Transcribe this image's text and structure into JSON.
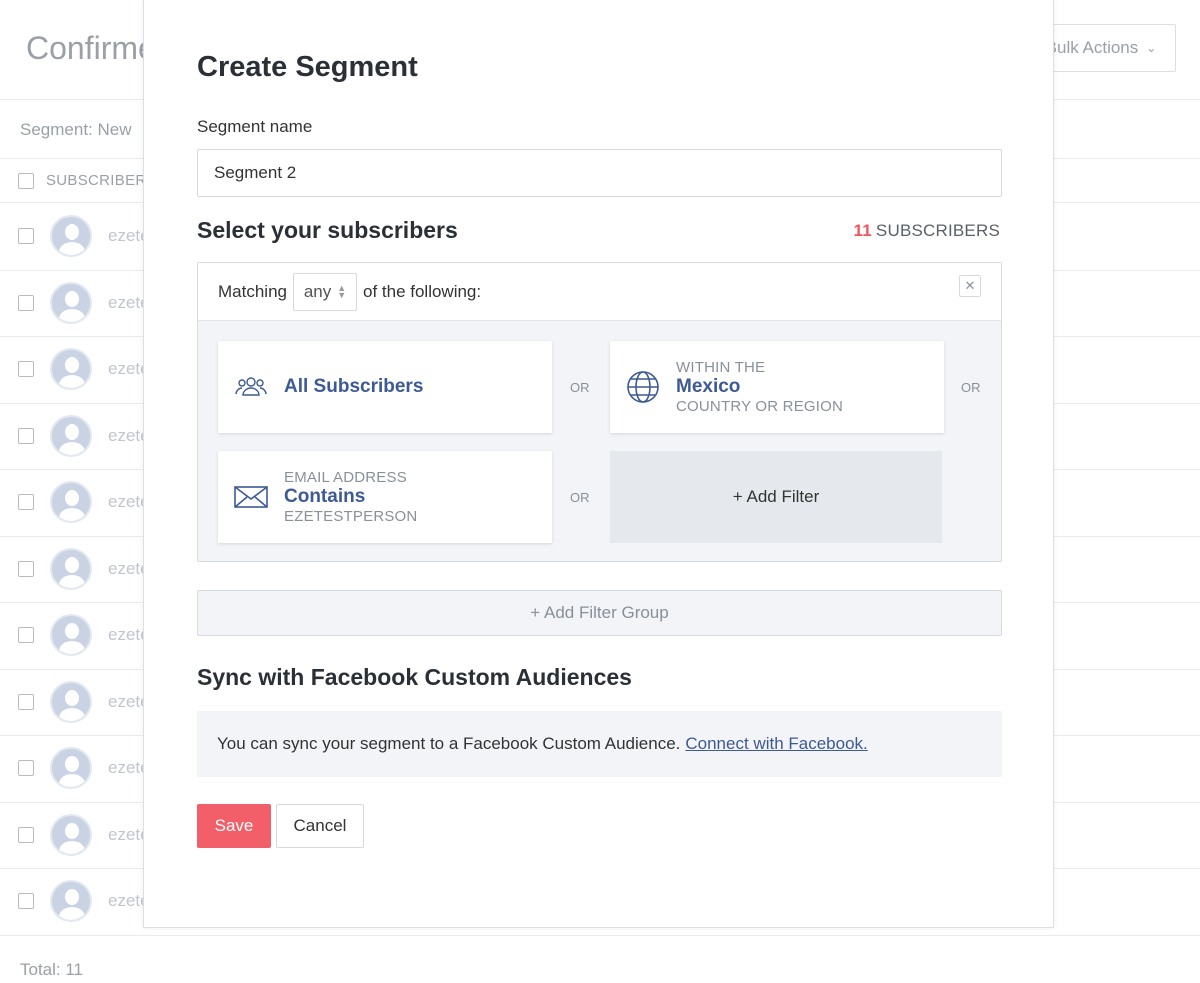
{
  "background": {
    "title": "Confirmed",
    "bulk_actions": "Bulk Actions",
    "segment_label": "Segment: New",
    "column_header": "SUBSCRIBERS",
    "rows": [
      "ezetestperson",
      "ezetestperson",
      "ezetestperson",
      "ezetestperson",
      "ezetestperson",
      "ezetestperson",
      "ezetestperson",
      "ezetestperson",
      "ezetestperson",
      "ezetestperson",
      "ezetestperson"
    ],
    "total": "Total: 11"
  },
  "modal": {
    "title": "Create Segment",
    "name_label": "Segment name",
    "name_value": "Segment 2",
    "select_heading": "Select your subscribers",
    "subscriber_count": "11",
    "subscriber_count_label": "SUBSCRIBERS",
    "matching_prefix": "Matching",
    "matching_value": "any",
    "matching_suffix": "of the following:",
    "filters": {
      "all": {
        "label": "All Subscribers"
      },
      "country": {
        "top": "WITHIN THE",
        "main": "Mexico",
        "bottom": "COUNTRY OR REGION"
      },
      "email": {
        "top": "EMAIL ADDRESS",
        "main": "Contains",
        "bottom": "EZETESTPERSON"
      },
      "or_label": "OR",
      "add_filter": "+ Add Filter"
    },
    "add_filter_group": "+ Add Filter Group",
    "facebook": {
      "heading": "Sync with Facebook Custom Audiences",
      "text": "You can sync your segment to a Facebook Custom Audience.",
      "link": "Connect with Facebook."
    },
    "save": "Save",
    "cancel": "Cancel"
  },
  "colors": {
    "accent": "#f35f68",
    "link": "#3d5a94",
    "count": "#f0555e"
  }
}
